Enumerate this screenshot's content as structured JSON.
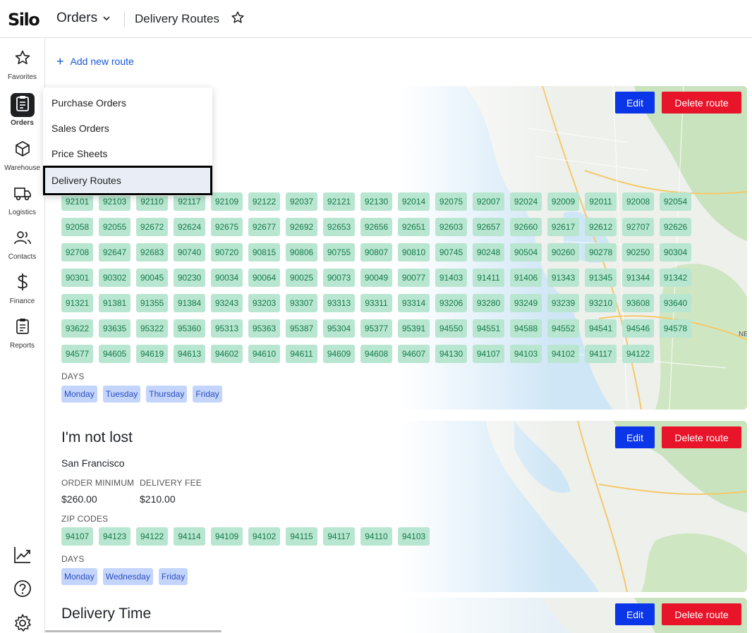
{
  "header": {
    "logo": "Silo",
    "module": "Orders",
    "page_title": "Delivery Routes"
  },
  "sidebar": {
    "items": [
      {
        "label": "Favorites",
        "icon": "star-icon"
      },
      {
        "label": "Orders",
        "icon": "clipboard-icon",
        "active": true
      },
      {
        "label": "Warehouse",
        "icon": "box-icon"
      },
      {
        "label": "Logistics",
        "icon": "truck-icon"
      },
      {
        "label": "Contacts",
        "icon": "users-icon"
      },
      {
        "label": "Finance",
        "icon": "dollar-icon"
      },
      {
        "label": "Reports",
        "icon": "report-icon"
      }
    ],
    "bottom_icons": [
      "trending-chart-icon",
      "help-icon",
      "settings-gear-icon"
    ]
  },
  "main": {
    "add_route_label": "Add new route",
    "edit_label": "Edit",
    "delete_label": "Delete route",
    "labels": {
      "order_minimum": "ORDER MINIMUM",
      "delivery_fee": "DELIVERY FEE",
      "zip_codes": "ZIP CODES",
      "days": "DAYS"
    },
    "routes": [
      {
        "zip_codes": [
          "92101",
          "92103",
          "92110",
          "92117",
          "92109",
          "92122",
          "92037",
          "92121",
          "92130",
          "92014",
          "92075",
          "92007",
          "92024",
          "92009",
          "92011",
          "92008",
          "92054",
          "92058",
          "92055",
          "92672",
          "92624",
          "92675",
          "92677",
          "92692",
          "92653",
          "92656",
          "92651",
          "92603",
          "92657",
          "92660",
          "92617",
          "92612",
          "92707",
          "92626",
          "92708",
          "92647",
          "92683",
          "90740",
          "90720",
          "90815",
          "90806",
          "90755",
          "90807",
          "90810",
          "90745",
          "90248",
          "90504",
          "90260",
          "90278",
          "90250",
          "90304",
          "90301",
          "90302",
          "90045",
          "90230",
          "90034",
          "90064",
          "90025",
          "90073",
          "90049",
          "90077",
          "91403",
          "91411",
          "91406",
          "91343",
          "91345",
          "91344",
          "91342",
          "91321",
          "91381",
          "91355",
          "91384",
          "93243",
          "93203",
          "93307",
          "93313",
          "93311",
          "93314",
          "93206",
          "93280",
          "93249",
          "93239",
          "93210",
          "93608",
          "93640",
          "93622",
          "93635",
          "95322",
          "95360",
          "95313",
          "95363",
          "95387",
          "95304",
          "95377",
          "95391",
          "94550",
          "94551",
          "94588",
          "94552",
          "94541",
          "94546",
          "94578",
          "94577",
          "94605",
          "94619",
          "94613",
          "94602",
          "94610",
          "94611",
          "94609",
          "94608",
          "94607",
          "94130",
          "94107",
          "94103",
          "94102",
          "94117",
          "94122"
        ],
        "days": [
          "Monday",
          "Tuesday",
          "Thursday",
          "Friday"
        ]
      },
      {
        "name": "I'm not lost",
        "city": "San Francisco",
        "order_minimum": "$260.00",
        "delivery_fee": "$210.00",
        "zip_codes": [
          "94107",
          "94123",
          "94122",
          "94114",
          "94109",
          "94102",
          "94115",
          "94117",
          "94110",
          "94103"
        ],
        "days": [
          "Monday",
          "Wednesday",
          "Friday"
        ]
      },
      {
        "name": "Delivery Time"
      }
    ],
    "map_labels": [
      "NEGI"
    ]
  },
  "dropdown": {
    "items": [
      "Purchase Orders",
      "Sales Orders",
      "Price Sheets",
      "Delivery Routes"
    ],
    "active_index": 3
  },
  "colors": {
    "edit_button": "#0a35e8",
    "delete_button": "#e8142a",
    "zip_chip_bg": "#b9e6d0",
    "zip_chip_text": "#147a4b",
    "day_chip_bg": "#c4d5fb",
    "day_chip_text": "#2b4dc0",
    "link": "#1a56d6"
  }
}
